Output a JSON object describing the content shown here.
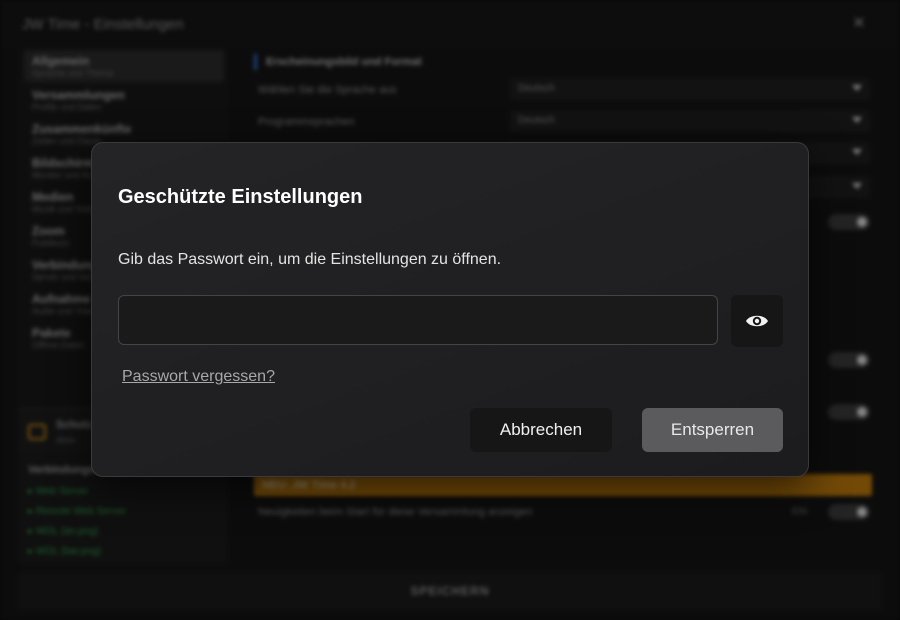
{
  "app": {
    "title": "JW Time - Einstellungen",
    "close_glyph": "✕",
    "sidebar": {
      "items": [
        {
          "label": "Allgemein",
          "sub": "Sprache und Thema",
          "active": true
        },
        {
          "label": "Versammlungen",
          "sub": "Profile und Daten"
        },
        {
          "label": "Zusammenkünfte",
          "sub": "Zeiten und Dauer"
        },
        {
          "label": "Bildschirm",
          "sub": "Monitor und Anzeige"
        },
        {
          "label": "Medien",
          "sub": "Musik und Video"
        },
        {
          "label": "Zoom",
          "sub": "Publikum"
        },
        {
          "label": "Verbindung",
          "sub": "Server und Netzwerk"
        },
        {
          "label": "Aufnahme",
          "sub": "Audio und Video"
        },
        {
          "label": "Pakete",
          "sub": "Offline-Daten"
        }
      ],
      "protect": {
        "label": "Schutz",
        "sub": "Aktiv"
      },
      "connections": {
        "title": "Verbindungen",
        "items": [
          "Web Server",
          "Remote Web Server",
          "WOL (an.png)",
          "WOL (bar.png)"
        ]
      }
    },
    "content": {
      "section_title": "Erscheinungsbild und Format",
      "language_label": "Wählen Sie die Sprache aus",
      "language_value": "Deutsch",
      "program_lang_label": "Programmsprachen",
      "program_lang_value": "Deutsch",
      "banner": "NEU: JW Time 4.2",
      "news_label": "Neuigkeiten beim Start für diese Versammlung anzeigen",
      "news_state": "EIN"
    },
    "save_label": "SPEICHERN"
  },
  "dialog": {
    "title": "Geschützte Einstellungen",
    "message": "Gib das Passwort ein, um die Einstellungen zu öffnen.",
    "password_value": "",
    "password_placeholder": "",
    "forgot_label": "Passwort vergessen?",
    "cancel_label": "Abbrechen",
    "unlock_label": "Entsperren",
    "icons": {
      "toggle_visibility": "eye-icon"
    }
  }
}
